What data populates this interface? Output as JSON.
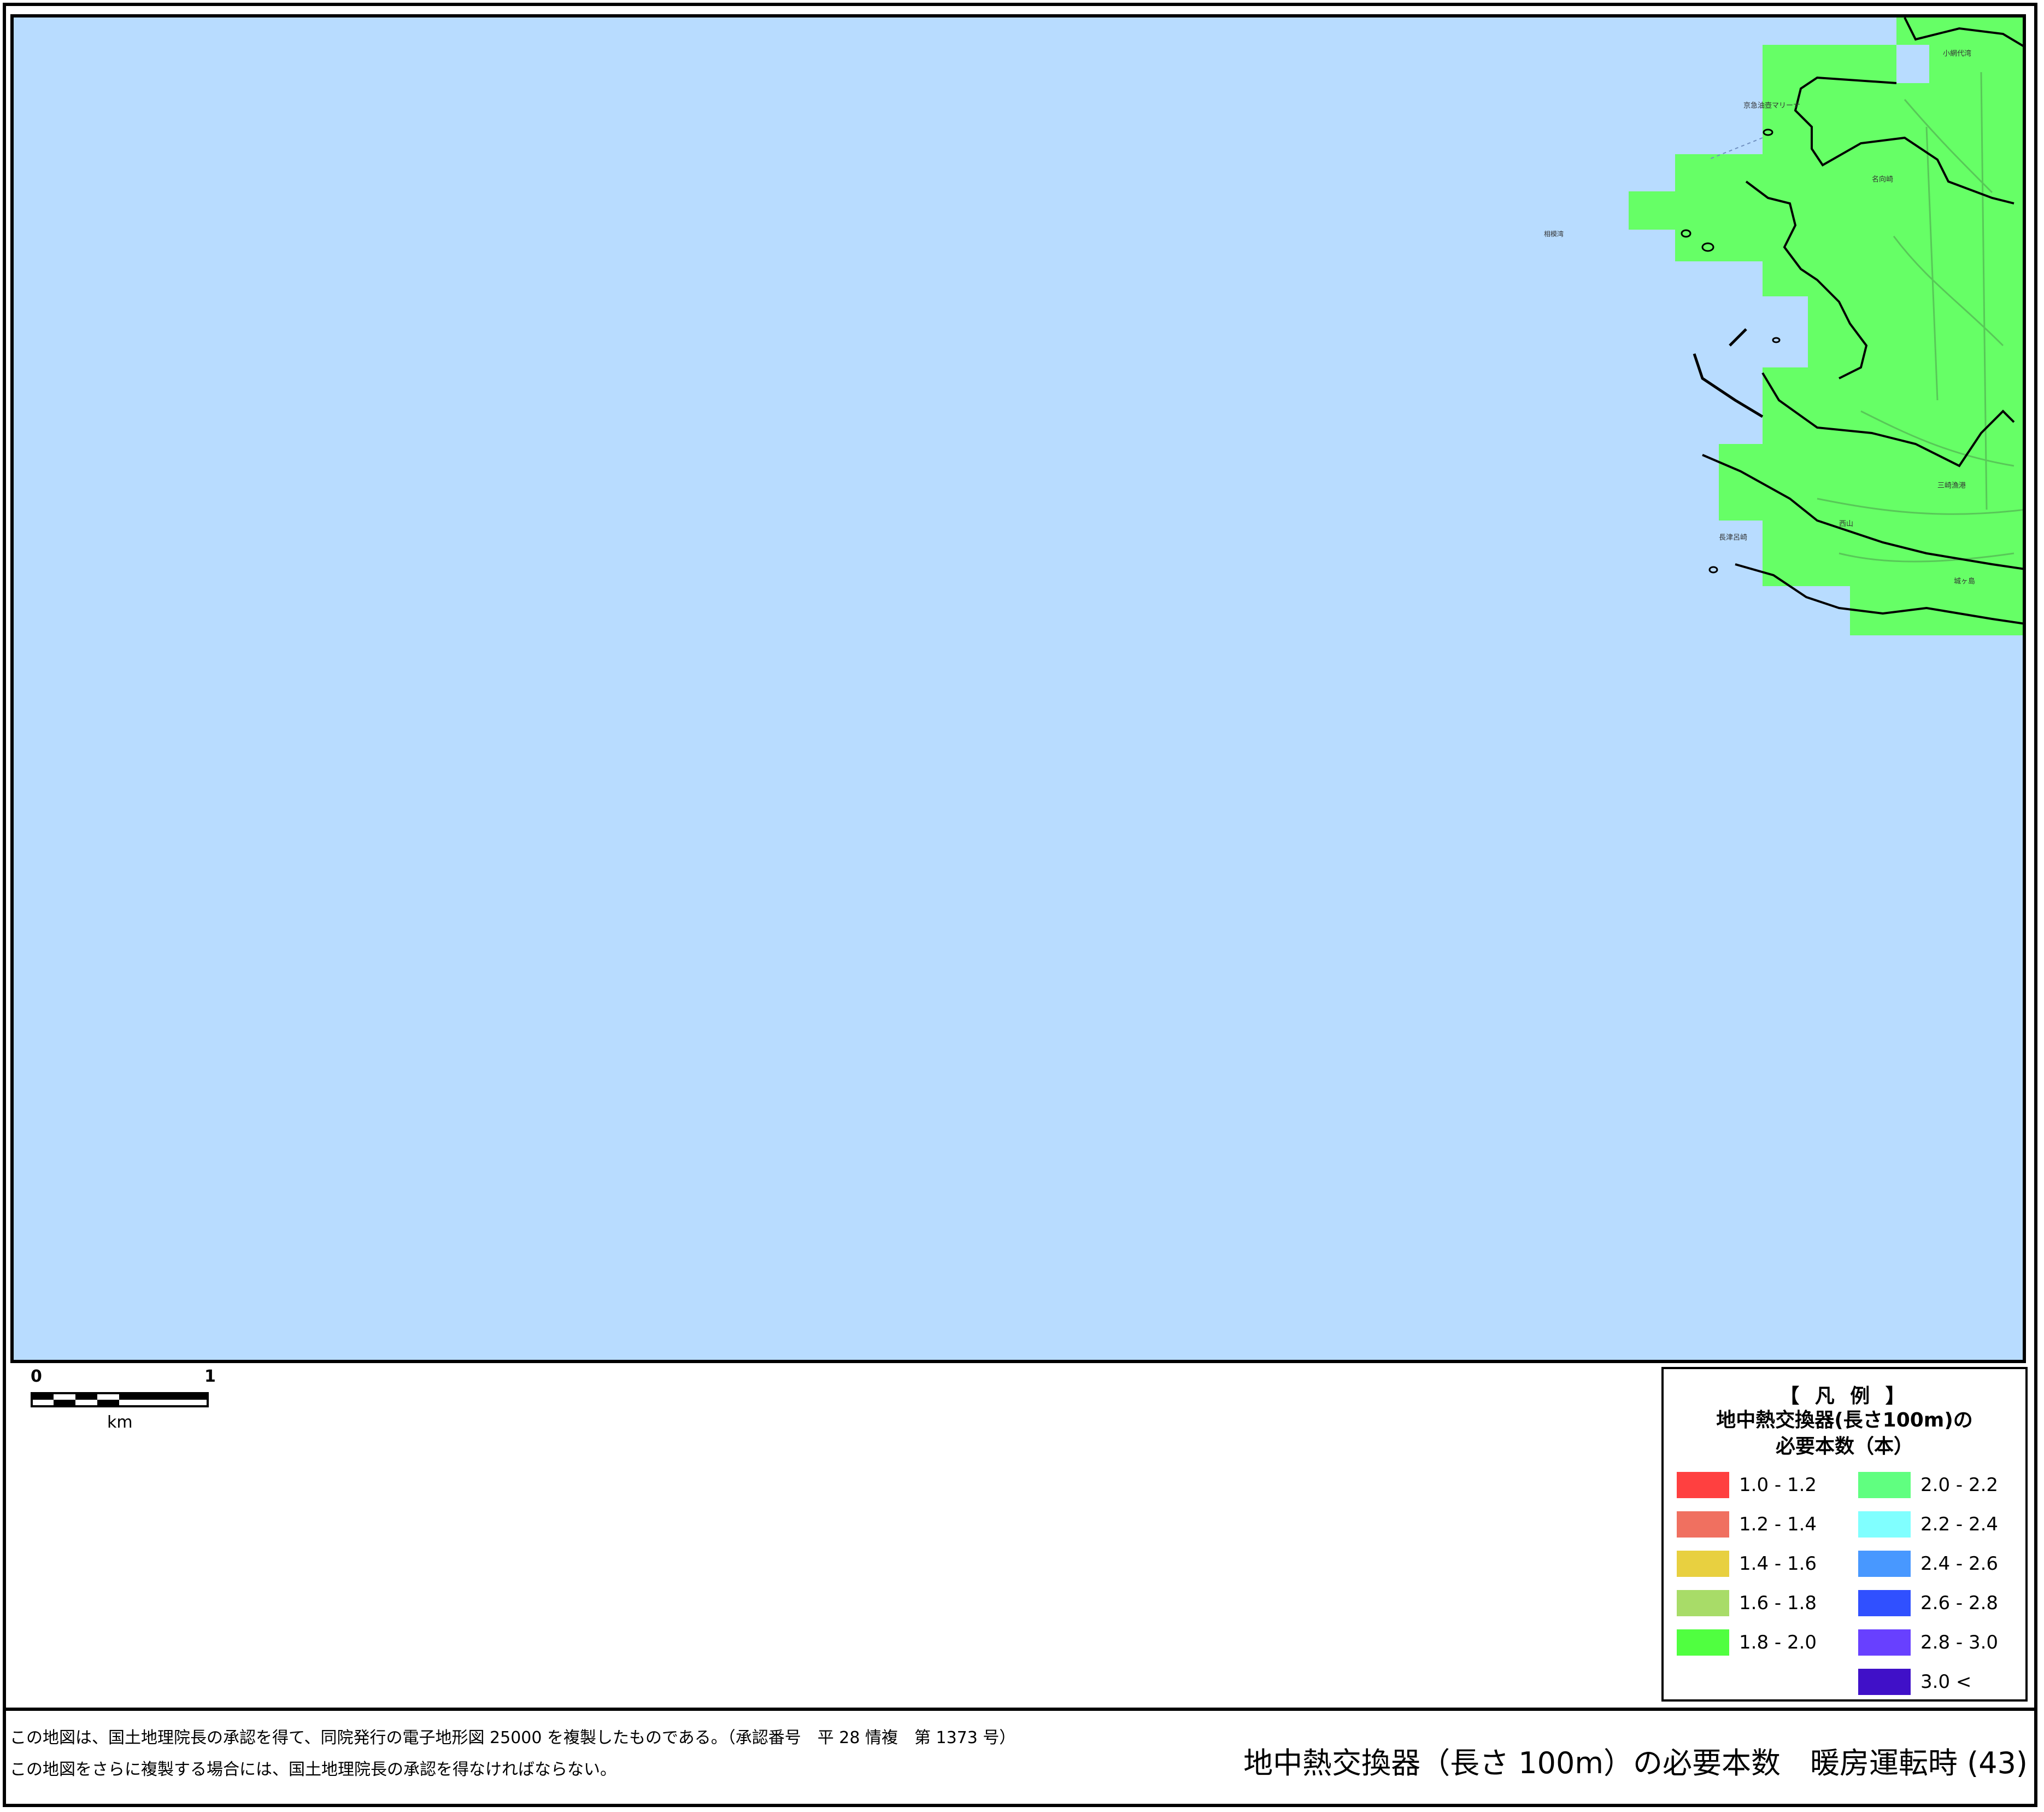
{
  "map": {
    "sea_color": "#b8dcff",
    "land_color": "#66ff66",
    "place_labels": [
      "小網代湾",
      "京急油壺マリーナ",
      "相模湾",
      "長津呂崎",
      "三崎漁港",
      "城ヶ島",
      "西山",
      "名向崎"
    ]
  },
  "scale": {
    "start": "0",
    "end": "1",
    "unit": "km"
  },
  "legend": {
    "title": "【 凡 例 】",
    "subtitle_line1": "地中熱交換器(長さ100m)の",
    "subtitle_line2": "必要本数（本）",
    "items": [
      {
        "label": "1.0 - 1.2",
        "color": "#ff4040"
      },
      {
        "label": "1.2 - 1.4",
        "color": "#f07060"
      },
      {
        "label": "1.4 - 1.6",
        "color": "#e8d040"
      },
      {
        "label": "1.6 - 1.8",
        "color": "#a8dc68"
      },
      {
        "label": "1.8 - 2.0",
        "color": "#50ff40"
      },
      {
        "label": "2.0 - 2.2",
        "color": "#60ff80"
      },
      {
        "label": "2.2 - 2.4",
        "color": "#80ffff"
      },
      {
        "label": "2.4 - 2.6",
        "color": "#4898ff"
      },
      {
        "label": "2.6 - 2.8",
        "color": "#3050ff"
      },
      {
        "label": "2.8 - 3.0",
        "color": "#6840ff"
      },
      {
        "label": "3.0 <",
        "color": "#4010c8"
      }
    ]
  },
  "footer": {
    "credit_line1": "この地図は、国土地理院長の承認を得て、同院発行の電子地形図 25000 を複製したものである。（承認番号　平 28 情複　第 1373 号）",
    "credit_line2": "この地図をさらに複製する場合には、国土地理院長の承認を得なければならない。",
    "title": "地中熱交換器（長さ 100m）の必要本数　暖房運転時 (43)"
  }
}
